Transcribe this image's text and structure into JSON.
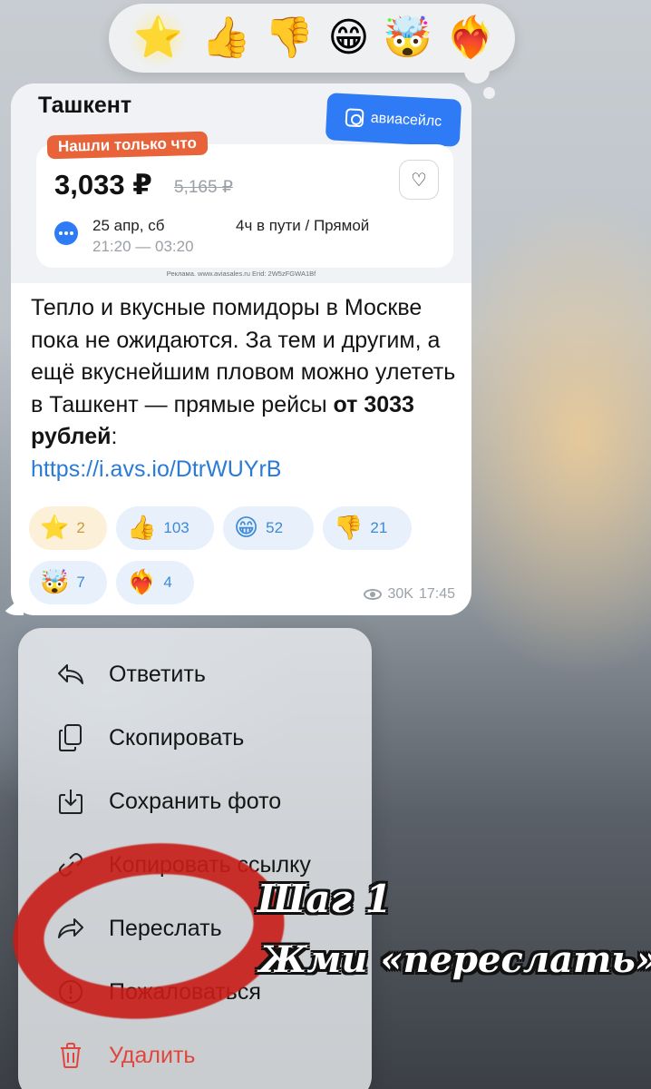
{
  "reaction_bar": {
    "emojis": [
      "⭐",
      "👍",
      "👎",
      "😁",
      "🤯",
      "❤️‍🔥"
    ]
  },
  "ad": {
    "city": "Ташкент",
    "brand": "авиасейлс",
    "badge": "Нашли только что",
    "price": "3,033 ₽",
    "old_price": "5,165 ₽",
    "date": "25 апр, сб",
    "time": "21:20 — 03:20",
    "route": "4ч в пути / Прямой",
    "footnote": "Реклама. www.aviasales.ru Erid: 2W5zFGWA1Bf"
  },
  "message": {
    "text": "Тепло и вкусные помидоры в Москве пока не ожидаются. За тем и другим, а ещё вкуснейшим пловом можно улететь в Ташкент — прямые рейсы ",
    "bold": "от 3033 рублей",
    "colon": ":",
    "link": "https://i.avs.io/DtrWUYrB",
    "views": "30K",
    "time": "17:45"
  },
  "reactions": [
    {
      "emoji": "⭐",
      "count": "2"
    },
    {
      "emoji": "👍",
      "count": "103"
    },
    {
      "emoji": "😁",
      "count": "52"
    },
    {
      "emoji": "👎",
      "count": "21"
    },
    {
      "emoji": "🤯",
      "count": "7"
    },
    {
      "emoji": "❤️‍🔥",
      "count": "4"
    }
  ],
  "menu": {
    "reply": "Ответить",
    "copy": "Скопировать",
    "save_photo": "Сохранить фото",
    "copy_link": "Копировать ссылку",
    "forward": "Переслать",
    "report": "Пожаловаться",
    "delete": "Удалить"
  },
  "annotation": {
    "step": "Шаг 1",
    "instruction": "Жми «переслать»"
  },
  "colors": {
    "accent": "#2a7bd6",
    "danger": "#e0463c",
    "badge": "#e8623a",
    "brand": "#2f7bf5",
    "highlight": "#c81c16"
  }
}
